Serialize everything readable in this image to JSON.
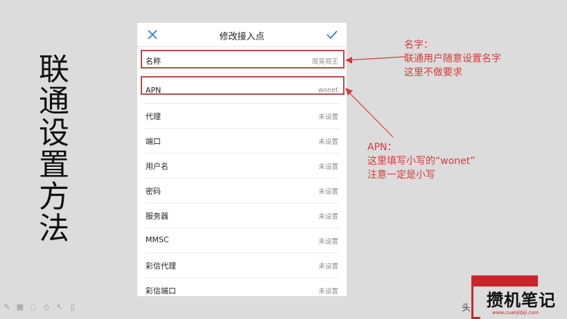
{
  "slide": {
    "vertical_title": [
      "联",
      "通",
      "设",
      "置",
      "方",
      "法"
    ]
  },
  "screen": {
    "title": "修改接入点",
    "close_icon": "close-icon",
    "confirm_icon": "check-icon",
    "rows": [
      {
        "label": "名称",
        "value": "周吴郑王"
      },
      {
        "label": "APN",
        "value": "wonet"
      },
      {
        "label": "代理",
        "value": "未设置"
      },
      {
        "label": "端口",
        "value": "未设置"
      },
      {
        "label": "用户名",
        "value": "未设置"
      },
      {
        "label": "密码",
        "value": "未设置"
      },
      {
        "label": "服务器",
        "value": "未设置"
      },
      {
        "label": "MMSC",
        "value": "未设置"
      },
      {
        "label": "彩信代理",
        "value": "未设置"
      },
      {
        "label": "彩信端口",
        "value": "未设置"
      }
    ]
  },
  "annotations": {
    "name_note": [
      "名字：",
      "联通用户随意设置名字",
      "这里不做要求"
    ],
    "apn_note": [
      "APN：",
      "这里填写小写的“wonet”",
      "注意一定是小写"
    ],
    "accent_color": "#d63b3b"
  },
  "watermark": {
    "text": "攒机笔记",
    "url": "www.cuanjibiji.com",
    "tail": "头"
  }
}
